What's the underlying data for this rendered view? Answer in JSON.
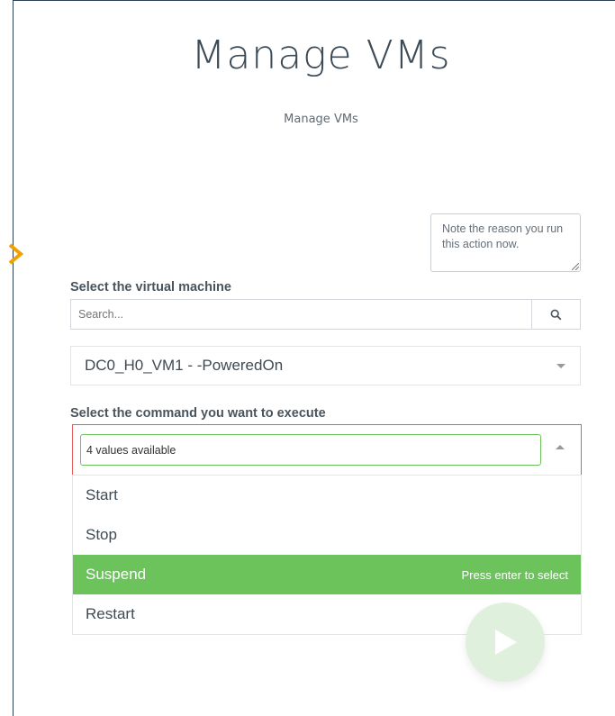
{
  "page": {
    "title": "Manage VMs",
    "subtitle": "Manage VMs"
  },
  "reason": {
    "placeholder": "Note the reason you run this action now."
  },
  "vm_section": {
    "label": "Select the virtual machine",
    "search_placeholder": "Search...",
    "search_icon": "magnifier-icon",
    "selected_vm": "DC0_H0_VM1 - -PoweredOn"
  },
  "command_section": {
    "label": "Select the command you want to execute",
    "input_value": "4 values available",
    "options": [
      {
        "label": "Start"
      },
      {
        "label": "Stop"
      },
      {
        "label": "Suspend",
        "hint": "Press enter to select"
      },
      {
        "label": "Restart"
      }
    ],
    "highlighted_index": 2
  },
  "run_button": {
    "icon": "play-icon"
  },
  "colors": {
    "accent_green": "#6cc35c",
    "error_red": "#e35d5d",
    "side_arrow": "#f2a000",
    "frame_border": "#2b3f55"
  }
}
